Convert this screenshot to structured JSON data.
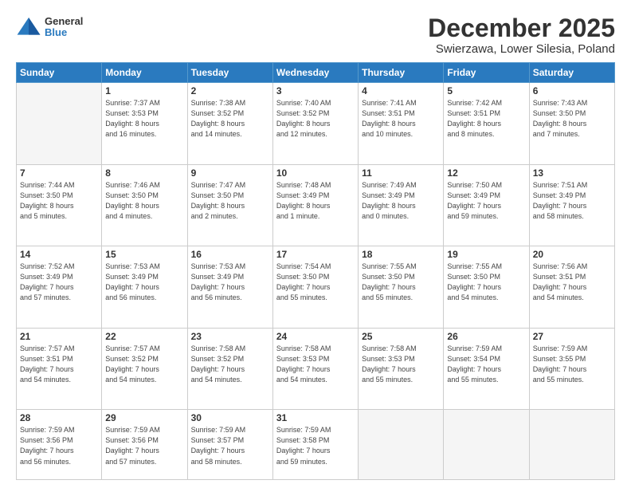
{
  "logo": {
    "general": "General",
    "blue": "Blue"
  },
  "title": "December 2025",
  "location": "Swierzawa, Lower Silesia, Poland",
  "weekdays": [
    "Sunday",
    "Monday",
    "Tuesday",
    "Wednesday",
    "Thursday",
    "Friday",
    "Saturday"
  ],
  "weeks": [
    [
      {
        "day": "",
        "info": ""
      },
      {
        "day": "1",
        "info": "Sunrise: 7:37 AM\nSunset: 3:53 PM\nDaylight: 8 hours\nand 16 minutes."
      },
      {
        "day": "2",
        "info": "Sunrise: 7:38 AM\nSunset: 3:52 PM\nDaylight: 8 hours\nand 14 minutes."
      },
      {
        "day": "3",
        "info": "Sunrise: 7:40 AM\nSunset: 3:52 PM\nDaylight: 8 hours\nand 12 minutes."
      },
      {
        "day": "4",
        "info": "Sunrise: 7:41 AM\nSunset: 3:51 PM\nDaylight: 8 hours\nand 10 minutes."
      },
      {
        "day": "5",
        "info": "Sunrise: 7:42 AM\nSunset: 3:51 PM\nDaylight: 8 hours\nand 8 minutes."
      },
      {
        "day": "6",
        "info": "Sunrise: 7:43 AM\nSunset: 3:50 PM\nDaylight: 8 hours\nand 7 minutes."
      }
    ],
    [
      {
        "day": "7",
        "info": "Sunrise: 7:44 AM\nSunset: 3:50 PM\nDaylight: 8 hours\nand 5 minutes."
      },
      {
        "day": "8",
        "info": "Sunrise: 7:46 AM\nSunset: 3:50 PM\nDaylight: 8 hours\nand 4 minutes."
      },
      {
        "day": "9",
        "info": "Sunrise: 7:47 AM\nSunset: 3:50 PM\nDaylight: 8 hours\nand 2 minutes."
      },
      {
        "day": "10",
        "info": "Sunrise: 7:48 AM\nSunset: 3:49 PM\nDaylight: 8 hours\nand 1 minute."
      },
      {
        "day": "11",
        "info": "Sunrise: 7:49 AM\nSunset: 3:49 PM\nDaylight: 8 hours\nand 0 minutes."
      },
      {
        "day": "12",
        "info": "Sunrise: 7:50 AM\nSunset: 3:49 PM\nDaylight: 7 hours\nand 59 minutes."
      },
      {
        "day": "13",
        "info": "Sunrise: 7:51 AM\nSunset: 3:49 PM\nDaylight: 7 hours\nand 58 minutes."
      }
    ],
    [
      {
        "day": "14",
        "info": "Sunrise: 7:52 AM\nSunset: 3:49 PM\nDaylight: 7 hours\nand 57 minutes."
      },
      {
        "day": "15",
        "info": "Sunrise: 7:53 AM\nSunset: 3:49 PM\nDaylight: 7 hours\nand 56 minutes."
      },
      {
        "day": "16",
        "info": "Sunrise: 7:53 AM\nSunset: 3:49 PM\nDaylight: 7 hours\nand 56 minutes."
      },
      {
        "day": "17",
        "info": "Sunrise: 7:54 AM\nSunset: 3:50 PM\nDaylight: 7 hours\nand 55 minutes."
      },
      {
        "day": "18",
        "info": "Sunrise: 7:55 AM\nSunset: 3:50 PM\nDaylight: 7 hours\nand 55 minutes."
      },
      {
        "day": "19",
        "info": "Sunrise: 7:55 AM\nSunset: 3:50 PM\nDaylight: 7 hours\nand 54 minutes."
      },
      {
        "day": "20",
        "info": "Sunrise: 7:56 AM\nSunset: 3:51 PM\nDaylight: 7 hours\nand 54 minutes."
      }
    ],
    [
      {
        "day": "21",
        "info": "Sunrise: 7:57 AM\nSunset: 3:51 PM\nDaylight: 7 hours\nand 54 minutes."
      },
      {
        "day": "22",
        "info": "Sunrise: 7:57 AM\nSunset: 3:52 PM\nDaylight: 7 hours\nand 54 minutes."
      },
      {
        "day": "23",
        "info": "Sunrise: 7:58 AM\nSunset: 3:52 PM\nDaylight: 7 hours\nand 54 minutes."
      },
      {
        "day": "24",
        "info": "Sunrise: 7:58 AM\nSunset: 3:53 PM\nDaylight: 7 hours\nand 54 minutes."
      },
      {
        "day": "25",
        "info": "Sunrise: 7:58 AM\nSunset: 3:53 PM\nDaylight: 7 hours\nand 55 minutes."
      },
      {
        "day": "26",
        "info": "Sunrise: 7:59 AM\nSunset: 3:54 PM\nDaylight: 7 hours\nand 55 minutes."
      },
      {
        "day": "27",
        "info": "Sunrise: 7:59 AM\nSunset: 3:55 PM\nDaylight: 7 hours\nand 55 minutes."
      }
    ],
    [
      {
        "day": "28",
        "info": "Sunrise: 7:59 AM\nSunset: 3:56 PM\nDaylight: 7 hours\nand 56 minutes."
      },
      {
        "day": "29",
        "info": "Sunrise: 7:59 AM\nSunset: 3:56 PM\nDaylight: 7 hours\nand 57 minutes."
      },
      {
        "day": "30",
        "info": "Sunrise: 7:59 AM\nSunset: 3:57 PM\nDaylight: 7 hours\nand 58 minutes."
      },
      {
        "day": "31",
        "info": "Sunrise: 7:59 AM\nSunset: 3:58 PM\nDaylight: 7 hours\nand 59 minutes."
      },
      {
        "day": "",
        "info": ""
      },
      {
        "day": "",
        "info": ""
      },
      {
        "day": "",
        "info": ""
      }
    ]
  ]
}
